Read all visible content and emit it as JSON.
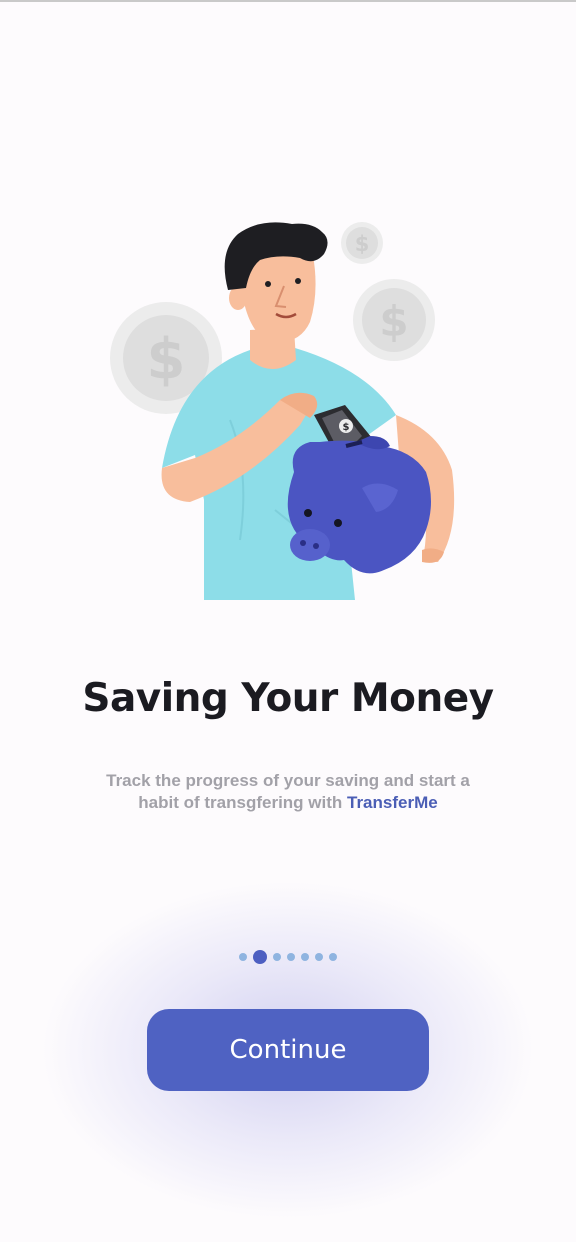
{
  "onboarding": {
    "title": "Saving Your Money",
    "subtitle_prefix": "Track the progress of your saving and start a habit of transgfering with ",
    "brand_name": "TransferMe",
    "pager": {
      "total": 7,
      "active_index": 1
    },
    "continue_label": "Continue"
  },
  "illustration": {
    "coin_symbol": "$",
    "icon": "man-saving-into-piggy-bank-illustration"
  },
  "colors": {
    "accent": "#4F62C2",
    "brand_text": "#4B5EB5",
    "title": "#1B1B21",
    "subtitle": "#A2A1A8",
    "dot_inactive": "#8FB4E0",
    "shirt": "#8DDDE8",
    "skin": "#F8BE9C",
    "piggy": "#4B55C2"
  }
}
